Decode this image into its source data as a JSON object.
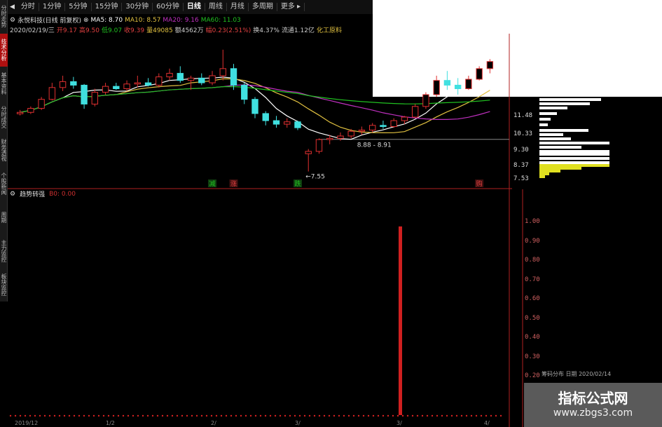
{
  "colors": {
    "background": "#000000",
    "up": "#e03030",
    "down": "#40e0e0",
    "ma5": "#ffffff",
    "ma10": "#e0c040",
    "ma20": "#c030c0",
    "ma60": "#20c020",
    "indicator": "#d02020"
  },
  "side_tabs": [
    {
      "label": "分时走势",
      "active": false
    },
    {
      "label": "技术分析",
      "active": true
    },
    {
      "label": "基本资料",
      "active": false
    },
    {
      "label": "分时成交",
      "active": false
    },
    {
      "label": "财务透视",
      "active": false
    },
    {
      "label": "个股新闻",
      "active": false
    },
    {
      "label": "周期",
      "active": false
    },
    {
      "label": "主力监控",
      "active": false
    },
    {
      "label": "板块监控",
      "active": false
    }
  ],
  "toolbar": {
    "items": [
      {
        "label": "分时",
        "active": false
      },
      {
        "label": "1分钟",
        "active": false
      },
      {
        "label": "5分钟",
        "active": false
      },
      {
        "label": "15分钟",
        "active": false
      },
      {
        "label": "30分钟",
        "active": false
      },
      {
        "label": "60分钟",
        "active": false
      },
      {
        "label": "日线",
        "active": true
      },
      {
        "label": "周线",
        "active": false
      },
      {
        "label": "月线",
        "active": false
      },
      {
        "label": "多周期",
        "active": false
      },
      {
        "label": "更多",
        "active": false
      }
    ]
  },
  "header": {
    "stock": "永悦科技(日线 前复权)",
    "ma5": "MA5: 8.70",
    "ma10": "MA10: 8.57",
    "ma20": "MA20: 9.16",
    "ma60": "MA60: 11.03",
    "date": "2020/02/19/三",
    "open": "开9.17",
    "high": "高9.50",
    "low": "低9.07",
    "close": "收9.39",
    "volume": "量49085",
    "amount": "额4562万",
    "change": "幅0.23(2.51%)",
    "turnover": "换4.37%",
    "float": "流通1.12亿",
    "sector": "化工原料"
  },
  "price_chart": {
    "ymin": 7.3,
    "ymax": 13.2,
    "support_line": 8.91,
    "low_mark": "←7.55",
    "range_label": "8.88 - 8.91",
    "signals": [
      {
        "text": "减",
        "color": "#20c020",
        "bg": "#104010",
        "index": 18
      },
      {
        "text": "涨",
        "color": "#e04040",
        "bg": "#401010",
        "index": 20
      },
      {
        "text": "跌",
        "color": "#20c020",
        "bg": "#104010",
        "index": 26
      },
      {
        "text": "购",
        "color": "#e04040",
        "bg": "#401010",
        "index": 43
      }
    ],
    "candles": [
      [
        9.99,
        10.15,
        9.92,
        10.05
      ],
      [
        10.05,
        10.3,
        9.98,
        10.22
      ],
      [
        10.22,
        10.7,
        10.15,
        10.6
      ],
      [
        10.6,
        11.3,
        10.55,
        11.1
      ],
      [
        11.1,
        11.6,
        10.95,
        11.35
      ],
      [
        11.35,
        11.55,
        11.05,
        11.2
      ],
      [
        11.2,
        11.25,
        10.2,
        10.4
      ],
      [
        10.4,
        11.05,
        10.3,
        10.9
      ],
      [
        10.9,
        11.3,
        10.8,
        11.15
      ],
      [
        11.15,
        11.3,
        11.0,
        11.05
      ],
      [
        11.05,
        11.4,
        10.95,
        11.25
      ],
      [
        11.25,
        11.6,
        11.1,
        11.3
      ],
      [
        11.3,
        11.5,
        11.15,
        11.2
      ],
      [
        11.2,
        11.7,
        11.1,
        11.55
      ],
      [
        11.55,
        11.9,
        11.4,
        11.7
      ],
      [
        11.7,
        12.0,
        11.3,
        11.4
      ],
      [
        11.4,
        11.6,
        11.0,
        11.5
      ],
      [
        11.5,
        11.7,
        11.2,
        11.3
      ],
      [
        11.3,
        11.8,
        11.2,
        11.6
      ],
      [
        11.6,
        12.7,
        11.4,
        11.9
      ],
      [
        11.9,
        12.1,
        11.0,
        11.2
      ],
      [
        11.2,
        11.3,
        10.4,
        10.6
      ],
      [
        10.6,
        10.7,
        9.8,
        10.0
      ],
      [
        10.0,
        10.1,
        9.5,
        9.7
      ],
      [
        9.7,
        9.9,
        9.4,
        9.55
      ],
      [
        9.55,
        9.8,
        9.4,
        9.65
      ],
      [
        9.65,
        9.7,
        9.3,
        9.4
      ],
      [
        8.3,
        8.5,
        7.55,
        8.4
      ],
      [
        8.4,
        8.95,
        8.3,
        8.9
      ],
      [
        8.9,
        9.1,
        8.7,
        8.95
      ],
      [
        8.95,
        9.2,
        8.85,
        9.05
      ],
      [
        9.05,
        9.35,
        8.95,
        9.25
      ],
      [
        9.25,
        9.45,
        9.1,
        9.3
      ],
      [
        9.3,
        9.6,
        9.2,
        9.5
      ],
      [
        9.5,
        9.7,
        9.35,
        9.45
      ],
      [
        9.45,
        9.8,
        9.4,
        9.7
      ],
      [
        9.7,
        9.9,
        9.55,
        9.85
      ],
      [
        9.85,
        10.4,
        9.8,
        10.3
      ],
      [
        10.3,
        10.9,
        10.2,
        10.8
      ],
      [
        10.8,
        11.6,
        10.7,
        11.4
      ],
      [
        11.4,
        11.8,
        11.0,
        11.2
      ],
      [
        11.2,
        11.5,
        10.8,
        11.05
      ],
      [
        11.05,
        11.6,
        11.0,
        11.45
      ],
      [
        11.45,
        12.0,
        11.4,
        11.9
      ],
      [
        11.9,
        12.3,
        11.7,
        12.2
      ]
    ]
  },
  "indicator": {
    "name": "趋势转强",
    "value": "B0: 0.00",
    "ymax": 1.1,
    "y_ticks": [
      "1.00",
      "0.90",
      "0.80",
      "0.70",
      "0.60",
      "0.50",
      "0.40",
      "0.30",
      "0.20"
    ],
    "signal_value": 0.98,
    "x_labels": [
      "2019/12",
      "1/2",
      "2/",
      "3/",
      "3/",
      "4/"
    ]
  },
  "profile": {
    "y_ticks": [
      "11.48",
      "10.33",
      "9.30",
      "8.37",
      "7.53"
    ]
  },
  "footer": {
    "date_stub": "筹码分布 日期 2020/02/14"
  },
  "watermark": {
    "title": "指标公式网",
    "url": "www.zbgs3.com"
  }
}
